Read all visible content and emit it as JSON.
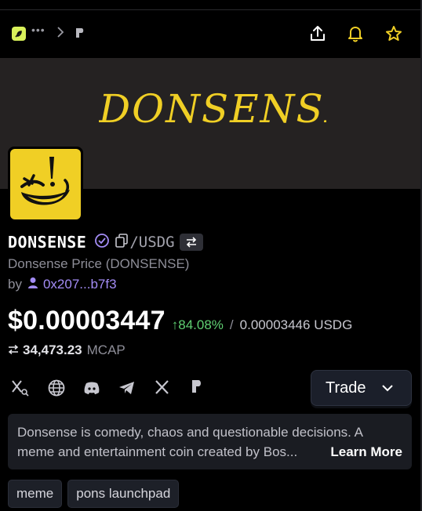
{
  "nav": {
    "dots": "•••",
    "icons": [
      "app-logo-icon",
      "chevron-right-icon",
      "pons-p-icon",
      "share-icon",
      "bell-icon",
      "star-icon"
    ]
  },
  "banner": {
    "text": "DONSENSE",
    "background_color": "#252222",
    "text_color": "#f0cf25"
  },
  "token": {
    "name": "DONSENSE",
    "pair": "/USDG",
    "subtitle": "Donsense Price (DONSENSE)",
    "by_label": "by",
    "creator": "0x207...b7f3",
    "price": "$0.00003447",
    "change": "↑84.08%",
    "separator": "/",
    "price_usdg": "0.00003446 USDG",
    "mcap_value": "34,473.23",
    "mcap_label": "MCAP"
  },
  "socials": [
    "x-search-icon",
    "globe-icon",
    "discord-icon",
    "telegram-icon",
    "x-icon",
    "pons-icon"
  ],
  "trade": {
    "label": "Trade"
  },
  "description": {
    "line1": "Donsense is comedy, chaos and questionable decisions. A",
    "line2": "meme and entertainment coin created by Bos...",
    "learn_more": "Learn More"
  },
  "tags": [
    "meme",
    "pons launchpad"
  ],
  "colors": {
    "accent_green": "#5fcf72",
    "accent_purple": "#a38cf5",
    "logo_yellow": "#f0cf25",
    "app_logo": "#d9f15a"
  }
}
